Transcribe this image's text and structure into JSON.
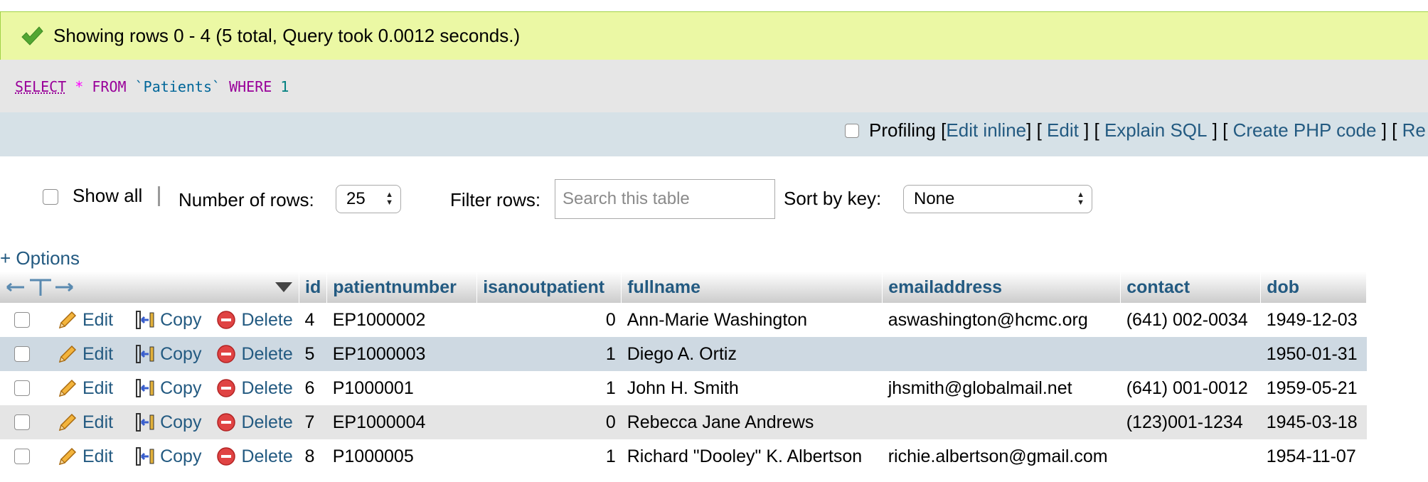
{
  "message": {
    "text": "Showing rows 0 - 4 (5 total, Query took 0.0012 seconds.)"
  },
  "sql": {
    "select": "SELECT",
    "star": "*",
    "from": "FROM",
    "table": "`Patients`",
    "where": "WHERE",
    "value": "1"
  },
  "tools": {
    "profiling": "Profiling",
    "edit_inline": "Edit inline",
    "edit": "Edit",
    "explain": "Explain SQL",
    "php": "Create PHP code",
    "refresh": "Re"
  },
  "nav": {
    "show_all": "Show all",
    "rows_label": "Number of rows:",
    "rows_value": "25",
    "filter_label": "Filter rows:",
    "filter_placeholder": "Search this table",
    "sort_label": "Sort by key:",
    "sort_value": "None"
  },
  "options_link": "+ Options",
  "table": {
    "columns": [
      "id",
      "patientnumber",
      "isanoutpatient",
      "fullname",
      "emailaddress",
      "contact",
      "dob"
    ],
    "actions": {
      "edit": "Edit",
      "copy": "Copy",
      "delete": "Delete"
    },
    "rows": [
      {
        "id": "4",
        "patientnumber": "EP1000002",
        "isanoutpatient": "0",
        "fullname": "Ann-Marie Washington",
        "emailaddress": "aswashington@hcmc.org",
        "contact": "(641) 002-0034",
        "dob": "1949-12-03"
      },
      {
        "id": "5",
        "patientnumber": "EP1000003",
        "isanoutpatient": "1",
        "fullname": "Diego A. Ortiz",
        "emailaddress": "",
        "contact": "",
        "dob": "1950-01-31"
      },
      {
        "id": "6",
        "patientnumber": "P1000001",
        "isanoutpatient": "1",
        "fullname": "John H. Smith",
        "emailaddress": "jhsmith@globalmail.net",
        "contact": "(641) 001-0012",
        "dob": "1959-05-21"
      },
      {
        "id": "7",
        "patientnumber": "EP1000004",
        "isanoutpatient": "0",
        "fullname": "Rebecca Jane Andrews",
        "emailaddress": "",
        "contact": "(123)001-1234",
        "dob": "1945-03-18"
      },
      {
        "id": "8",
        "patientnumber": "P1000005",
        "isanoutpatient": "1",
        "fullname": "Richard \"Dooley\" K. Albertson",
        "emailaddress": "richie.albertson@gmail.com",
        "contact": "",
        "dob": "1954-11-07"
      }
    ]
  },
  "colors": {
    "link": "#235a81",
    "success_bg": "#ebf8a4",
    "highlight_row": "#ced9e2"
  }
}
